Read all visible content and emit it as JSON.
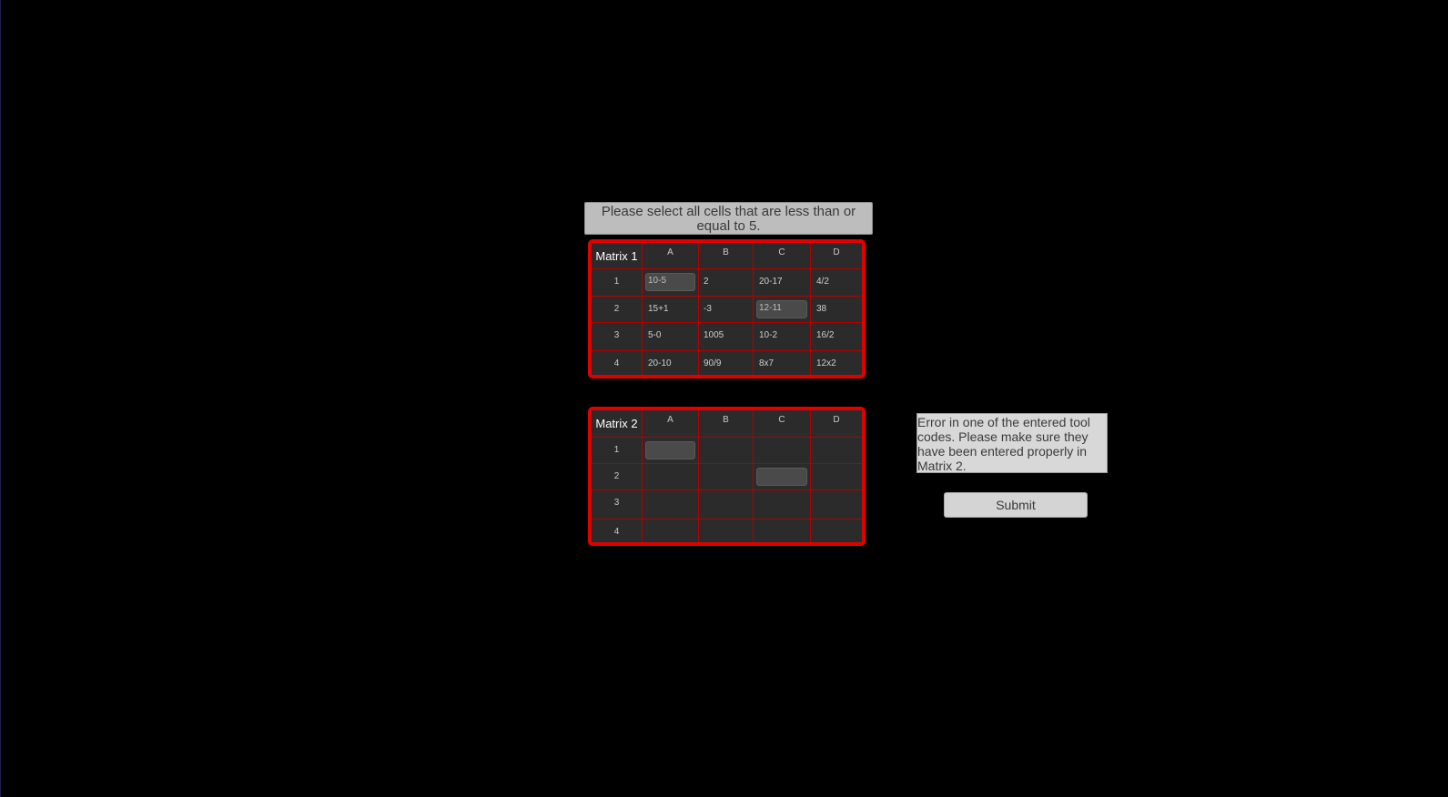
{
  "instruction": "Please select all cells that are less than or equal to 5.",
  "matrix1": {
    "title": "Matrix 1",
    "columns": [
      "A",
      "B",
      "C",
      "D"
    ],
    "rows": [
      {
        "label": "1",
        "cells": [
          "10-5",
          "2",
          "20-17",
          "4/2"
        ]
      },
      {
        "label": "2",
        "cells": [
          "15+1",
          "-3",
          "12-11",
          "38"
        ]
      },
      {
        "label": "3",
        "cells": [
          "5-0",
          "1005",
          "10-2",
          "16/2"
        ]
      },
      {
        "label": "4",
        "cells": [
          "20-10",
          "90/9",
          "8x7",
          "12x2"
        ]
      }
    ],
    "selected": [
      "A1",
      "C2"
    ]
  },
  "matrix2": {
    "title": "Matrix 2",
    "columns": [
      "A",
      "B",
      "C",
      "D"
    ],
    "rows": [
      {
        "label": "1",
        "cells": [
          "",
          "",
          "",
          ""
        ]
      },
      {
        "label": "2",
        "cells": [
          "",
          "",
          "",
          ""
        ]
      },
      {
        "label": "3",
        "cells": [
          "",
          "",
          "",
          ""
        ]
      },
      {
        "label": "4",
        "cells": [
          "",
          "",
          "",
          ""
        ]
      }
    ],
    "selected": [
      "A1",
      "C2"
    ]
  },
  "error_message": "Error in one of the entered tool codes. Please make sure they have been entered properly in Matrix 2.",
  "submit_label": "Submit",
  "colors": {
    "background": "#000000",
    "matrix_border": "#e00000",
    "cell_bg": "#2b2b2b",
    "selected_bg": "#4a4a4a"
  }
}
